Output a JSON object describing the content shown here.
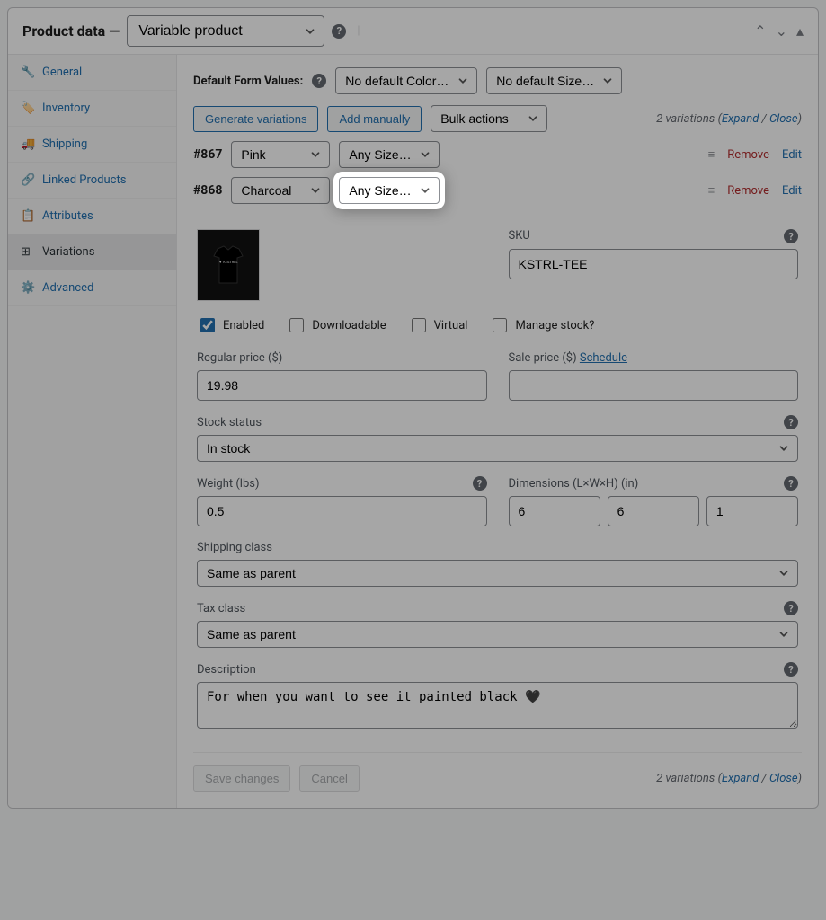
{
  "header": {
    "title_prefix": "Product data —",
    "product_type": "Variable product"
  },
  "sidebar": {
    "items": [
      {
        "label": "General"
      },
      {
        "label": "Inventory"
      },
      {
        "label": "Shipping"
      },
      {
        "label": "Linked Products"
      },
      {
        "label": "Attributes"
      },
      {
        "label": "Variations"
      },
      {
        "label": "Advanced"
      }
    ],
    "active_index": 5
  },
  "defaults": {
    "label": "Default Form Values:",
    "color_select": "No default Color…",
    "size_select": "No default Size…"
  },
  "toolbar": {
    "generate": "Generate variations",
    "add_manual": "Add manually",
    "bulk": "Bulk actions",
    "count_prefix": "2",
    "count_suffix": "variations",
    "expand": "Expand",
    "close": "Close"
  },
  "variations": [
    {
      "id": "#867",
      "color": "Pink",
      "size": "Any Size…",
      "remove": "Remove",
      "edit": "Edit"
    },
    {
      "id": "#868",
      "color": "Charcoal",
      "size": "Any Size…",
      "remove": "Remove",
      "edit": "Edit"
    }
  ],
  "detail": {
    "sku_label": "SKU",
    "sku_value": "KSTRL-TEE",
    "enabled": "Enabled",
    "downloadable": "Downloadable",
    "virtual": "Virtual",
    "manage_stock": "Manage stock?",
    "regular_price_label": "Regular price ($)",
    "regular_price_value": "19.98",
    "sale_price_label": "Sale price ($)",
    "schedule": "Schedule",
    "stock_status_label": "Stock status",
    "stock_status_value": "In stock",
    "weight_label": "Weight (lbs)",
    "weight_value": "0.5",
    "dimensions_label": "Dimensions (L×W×H) (in)",
    "dim_l": "6",
    "dim_w": "6",
    "dim_h": "1",
    "shipping_class_label": "Shipping class",
    "shipping_class_value": "Same as parent",
    "tax_class_label": "Tax class",
    "tax_class_value": "Same as parent",
    "description_label": "Description",
    "description_value": "For when you want to see it painted black 🖤"
  },
  "footer": {
    "save": "Save changes",
    "cancel": "Cancel"
  }
}
